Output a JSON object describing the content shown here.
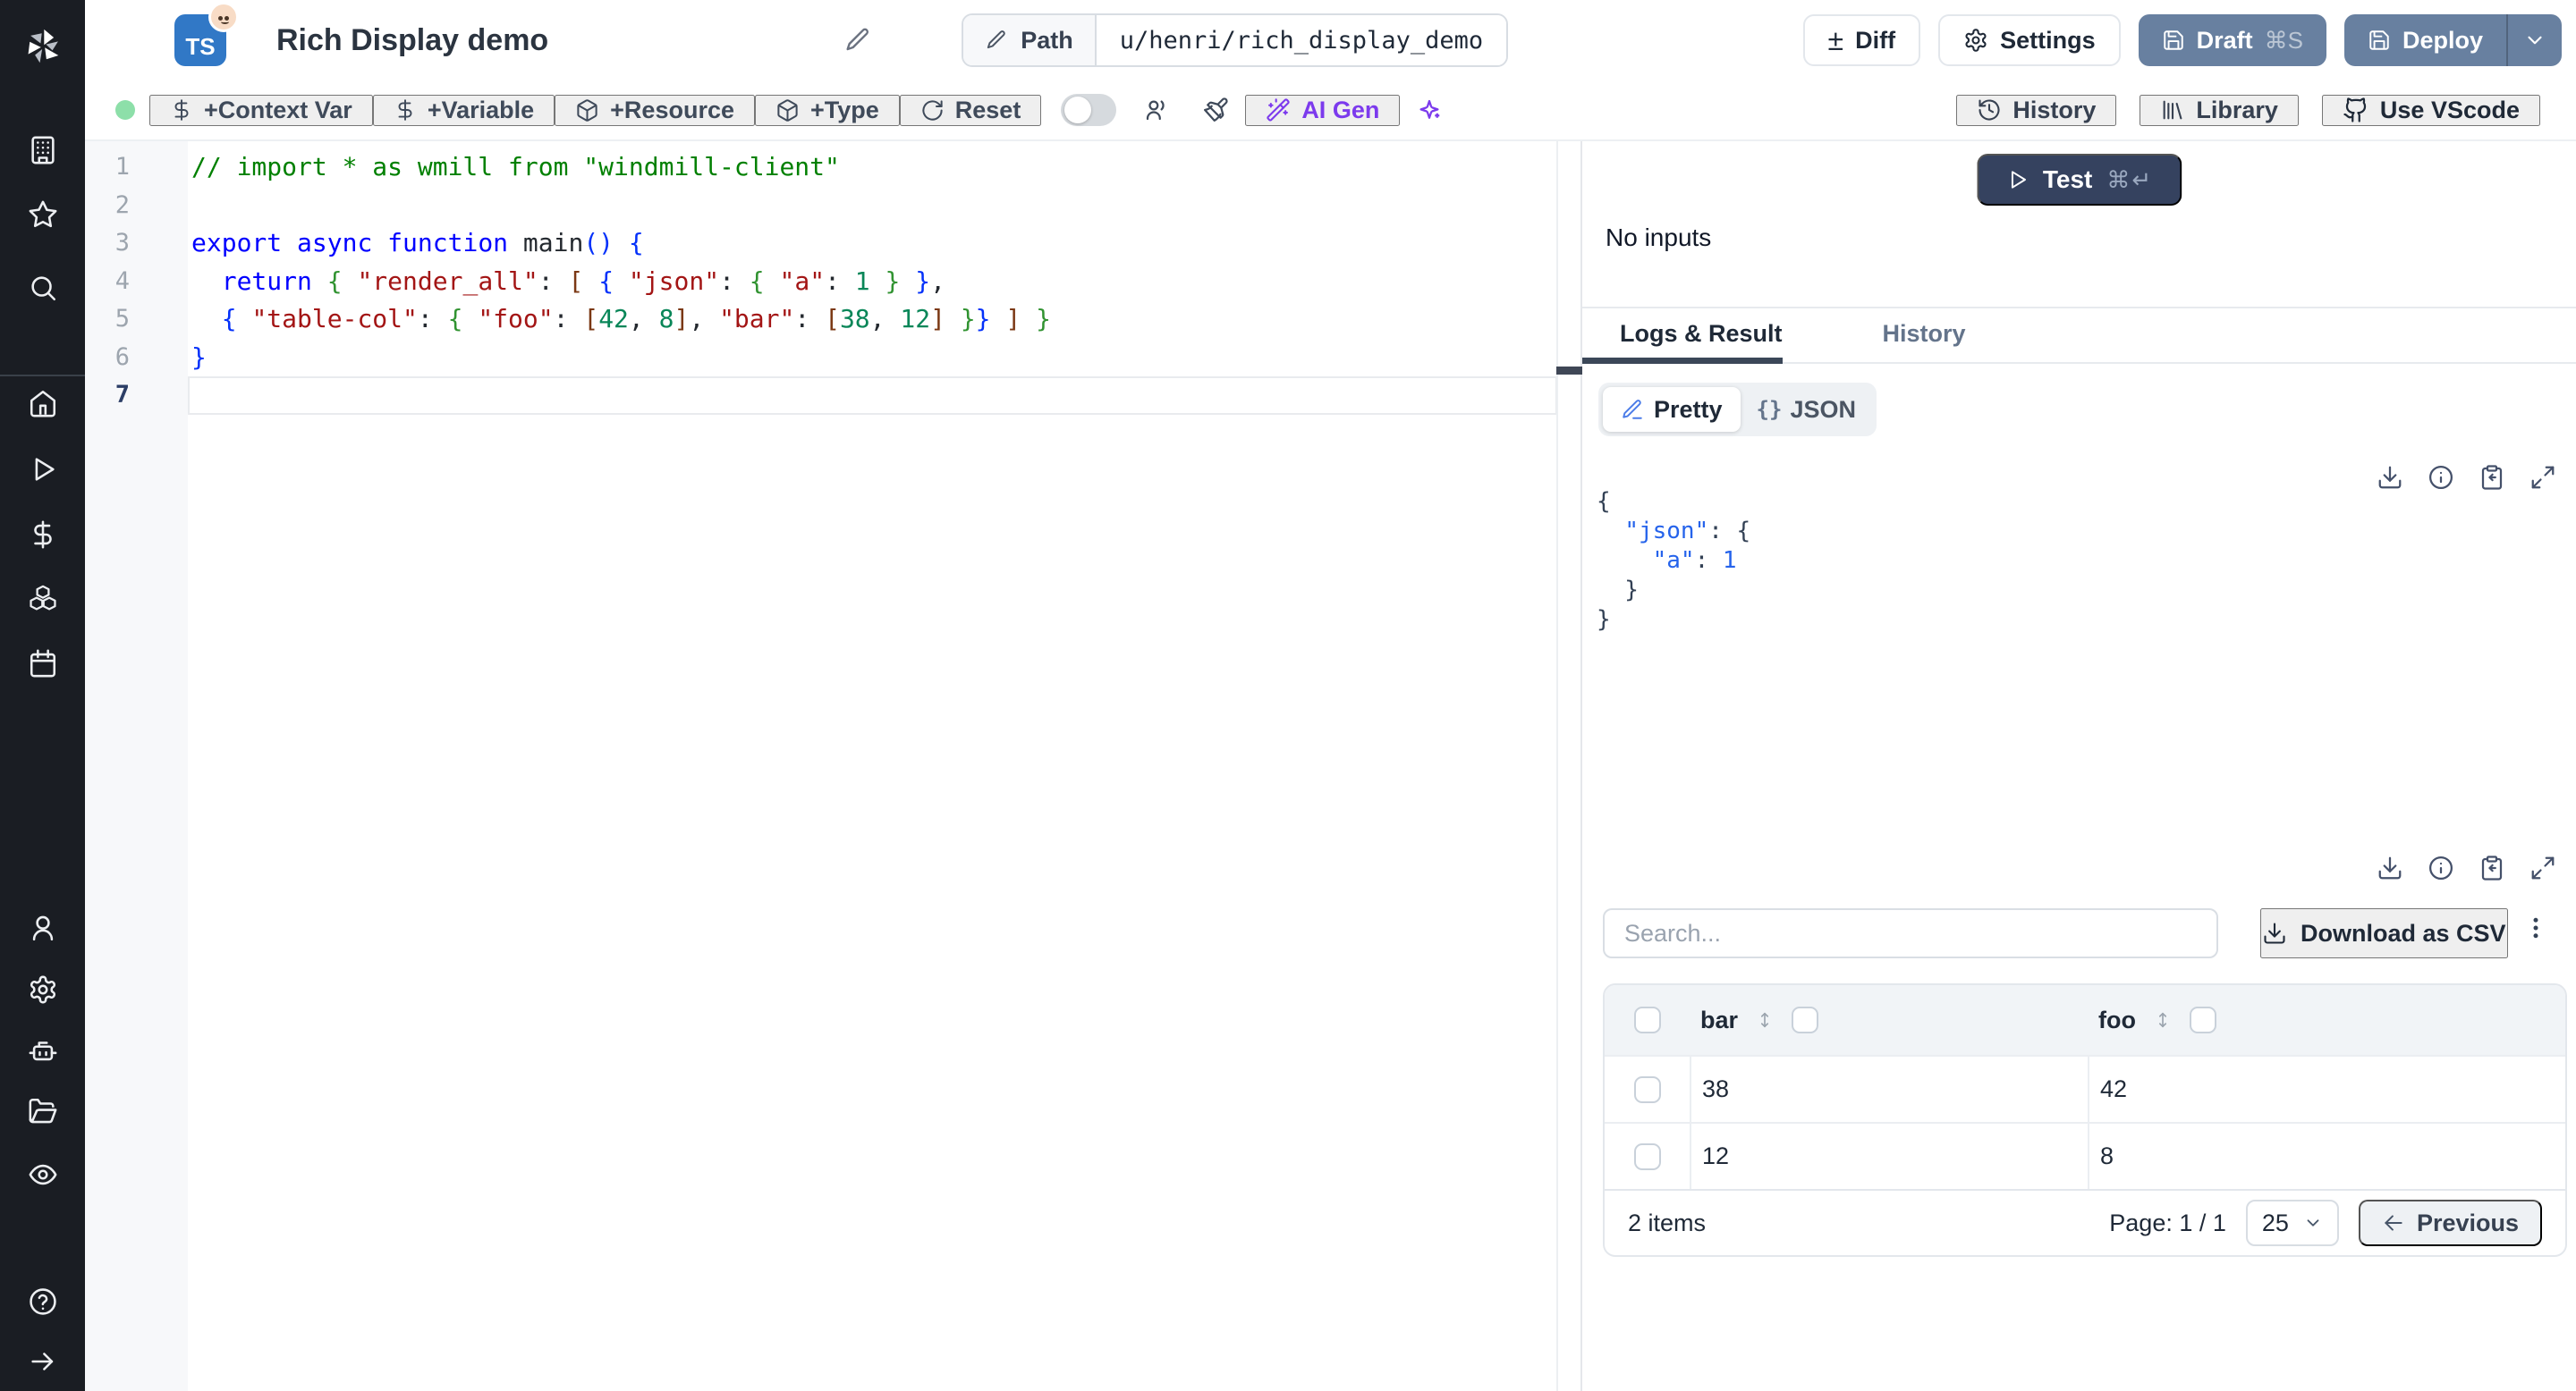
{
  "header": {
    "title": "Rich Display demo",
    "lang_badge": "TS",
    "path_label": "Path",
    "path_value": "u/henri/rich_display_demo",
    "buttons": {
      "diff_glyph": "±",
      "diff": "Diff",
      "settings": "Settings",
      "draft": "Draft",
      "draft_kbd": "⌘S",
      "deploy": "Deploy"
    }
  },
  "toolbar": {
    "context_var": "+Context Var",
    "variable": "+Variable",
    "resource": "+Resource",
    "type": "+Type",
    "reset": "Reset",
    "ai_gen": "AI Gen",
    "history": "History",
    "library": "Library",
    "use_vscode": "Use VScode"
  },
  "sidebar": {
    "icons": [
      "windmill-logo",
      "building",
      "star",
      "search",
      "home",
      "runs-play",
      "variables-dollar",
      "resources-cubes",
      "schedules-calendar",
      "user",
      "settings-gear",
      "workers-robot",
      "folders",
      "audit-eye",
      "help",
      "collapse-arrow"
    ]
  },
  "run": {
    "test": "Test",
    "test_kbd": "⌘↵",
    "no_inputs": "No inputs"
  },
  "tabs": {
    "logs_result": "Logs & Result",
    "history": "History"
  },
  "result": {
    "view_pretty": "Pretty",
    "view_json": "JSON",
    "braces": "{}",
    "lines": [
      [
        [
          "p",
          "{"
        ]
      ],
      [
        [
          "p",
          "  "
        ],
        [
          "k",
          "\"json\""
        ],
        [
          "p",
          ": {"
        ]
      ],
      [
        [
          "p",
          "    "
        ],
        [
          "k",
          "\"a\""
        ],
        [
          "p",
          ": "
        ],
        [
          "v",
          "1"
        ]
      ],
      [
        [
          "p",
          "  }"
        ]
      ],
      [
        [
          "p",
          "}"
        ]
      ]
    ]
  },
  "editor": {
    "lines": [
      {
        "num": "1",
        "tokens": [
          [
            "cm",
            "// import * as wmill from \"windmill-client\""
          ]
        ]
      },
      {
        "num": "2",
        "tokens": []
      },
      {
        "num": "3",
        "tokens": [
          [
            "kw",
            "export"
          ],
          [
            "pl",
            " "
          ],
          [
            "kw",
            "async"
          ],
          [
            "pl",
            " "
          ],
          [
            "kw",
            "function"
          ],
          [
            "fn",
            " main"
          ],
          [
            "b1",
            "()"
          ],
          [
            "pl",
            " "
          ],
          [
            "b1",
            "{"
          ]
        ]
      },
      {
        "num": "4",
        "tokens": [
          [
            "pl",
            "  "
          ],
          [
            "kw",
            "return"
          ],
          [
            "pl",
            " "
          ],
          [
            "b2",
            "{"
          ],
          [
            "pl",
            " "
          ],
          [
            "st",
            "\"render_all\""
          ],
          [
            "pl",
            ": "
          ],
          [
            "b3",
            "["
          ],
          [
            "pl",
            " "
          ],
          [
            "b1",
            "{"
          ],
          [
            "pl",
            " "
          ],
          [
            "st",
            "\"json\""
          ],
          [
            "pl",
            ": "
          ],
          [
            "b2",
            "{"
          ],
          [
            "pl",
            " "
          ],
          [
            "st",
            "\"a\""
          ],
          [
            "pl",
            ": "
          ],
          [
            "nm",
            "1"
          ],
          [
            "pl",
            " "
          ],
          [
            "b2",
            "}"
          ],
          [
            "pl",
            " "
          ],
          [
            "b1",
            "}"
          ],
          [
            "pl",
            ","
          ]
        ]
      },
      {
        "num": "5",
        "tokens": [
          [
            "pl",
            "  "
          ],
          [
            "b1",
            "{"
          ],
          [
            "pl",
            " "
          ],
          [
            "st",
            "\"table-col\""
          ],
          [
            "pl",
            ": "
          ],
          [
            "b2",
            "{"
          ],
          [
            "pl",
            " "
          ],
          [
            "st",
            "\"foo\""
          ],
          [
            "pl",
            ": "
          ],
          [
            "b3",
            "["
          ],
          [
            "nm",
            "42"
          ],
          [
            "pl",
            ", "
          ],
          [
            "nm",
            "8"
          ],
          [
            "b3",
            "]"
          ],
          [
            "pl",
            ", "
          ],
          [
            "st",
            "\"bar\""
          ],
          [
            "pl",
            ": "
          ],
          [
            "b3",
            "["
          ],
          [
            "nm",
            "38"
          ],
          [
            "pl",
            ", "
          ],
          [
            "nm",
            "12"
          ],
          [
            "b3",
            "]"
          ],
          [
            "pl",
            " "
          ],
          [
            "b2",
            "}"
          ],
          [
            "b1",
            "}"
          ],
          [
            "pl",
            " "
          ],
          [
            "b3",
            "]"
          ],
          [
            "pl",
            " "
          ],
          [
            "b2",
            "}"
          ]
        ]
      },
      {
        "num": "6",
        "tokens": [
          [
            "b1",
            "}"
          ]
        ]
      },
      {
        "num": "7",
        "tokens": [],
        "current": true
      }
    ]
  },
  "table": {
    "search_placeholder": "Search...",
    "download_csv": "Download as CSV",
    "columns": [
      {
        "id": "bar",
        "label": "bar"
      },
      {
        "id": "foo",
        "label": "foo"
      }
    ],
    "rows": [
      {
        "bar": "38",
        "foo": "42"
      },
      {
        "bar": "12",
        "foo": "8"
      }
    ],
    "footer": {
      "items": "2 items",
      "page": "Page: 1 / 1",
      "page_size": "25",
      "previous": "Previous"
    }
  },
  "colors": {
    "slate_button": "#6880a0",
    "test_button": "#35425f",
    "ai_purple": "#7c3aed",
    "saved_dot_green": "#8ddfa9",
    "ts_blue": "#3178c6",
    "tab_underline": "#3b4758"
  }
}
